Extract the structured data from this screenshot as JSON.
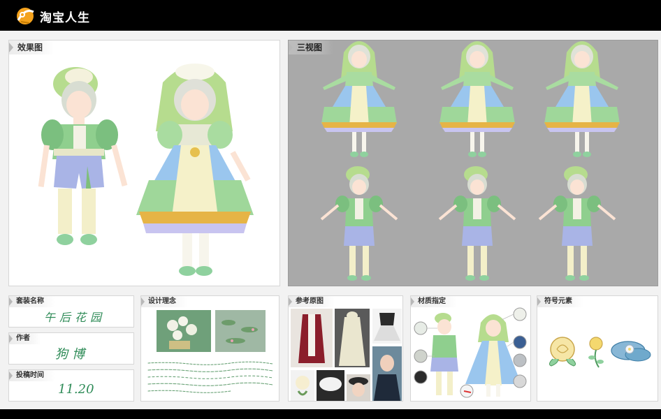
{
  "header": {
    "title": "淘宝人生"
  },
  "panels": {
    "effect": {
      "label": "效果图"
    },
    "three_view": {
      "label": "三视图"
    },
    "suit_name": {
      "label": "套装名称",
      "value": "午后花园"
    },
    "author": {
      "label": "作者",
      "value": "狗博"
    },
    "submit_time": {
      "label": "投稿时间",
      "value": "11.20"
    },
    "concept": {
      "label": "设计理念"
    },
    "reference": {
      "label": "参考原图"
    },
    "material": {
      "label": "材质指定"
    },
    "symbol": {
      "label": "符号元素"
    }
  },
  "colors": {
    "accent_green": "#8fd19e",
    "lilac": "#a9b4e6",
    "cream": "#f3efc9",
    "gold": "#e6b446"
  }
}
